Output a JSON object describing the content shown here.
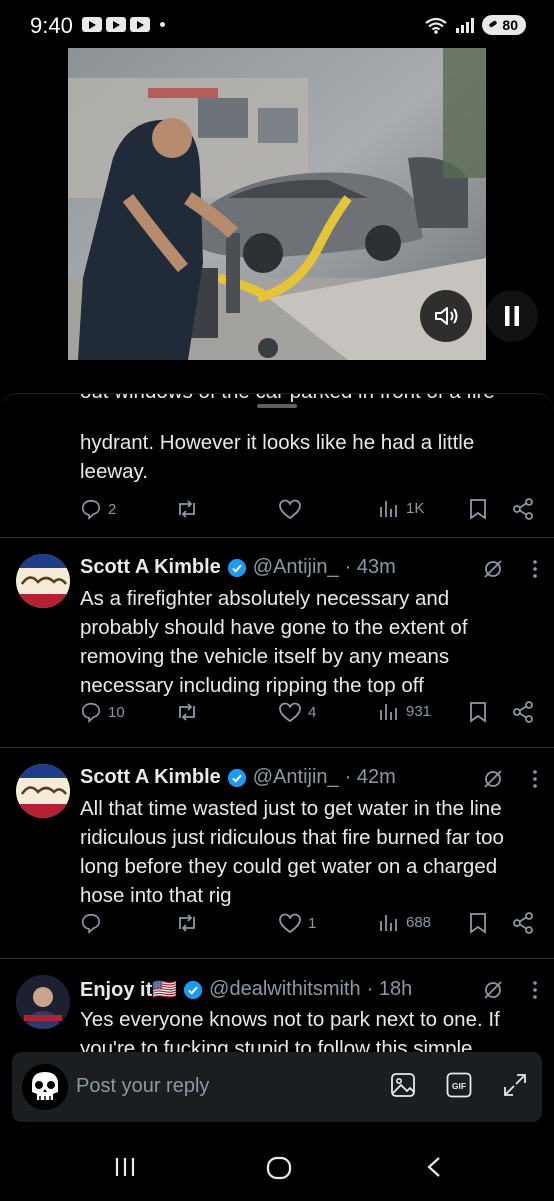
{
  "status_bar": {
    "time": "9:40",
    "battery": "80",
    "wifi_label": "6"
  },
  "video": {
    "sound_icon": "volume-icon",
    "pause_icon": "pause-icon"
  },
  "partial_tweet": {
    "cut_line": "out windows of the car parked in front of a fire",
    "text": "hydrant.  However it looks like he had a little leeway.",
    "replies": "2",
    "reposts": "",
    "likes": "",
    "views": "1K"
  },
  "tweets": [
    {
      "name": "Scott A Kimble",
      "handle": "@Antijin_",
      "time": "· 43m",
      "body": "As a firefighter absolutely necessary and probably should have gone to the extent of removing the vehicle itself by any means necessary including ripping the top off",
      "replies": "10",
      "reposts": "",
      "likes": "4",
      "views": "931"
    },
    {
      "name": "Scott A Kimble",
      "handle": "@Antijin_",
      "time": "· 42m",
      "body": "All that time wasted just to get water in the line ridiculous just ridiculous that fire burned far too long before they could get water on a charged hose into that rig",
      "replies": "",
      "reposts": "",
      "likes": "1",
      "views": "688"
    },
    {
      "name": "Enjoy it🇺🇸",
      "handle": "@dealwithitsmith",
      "time": "· 18h",
      "body": "Yes everyone knows not to park next to one. If you're to fucking stupid to follow this simple"
    }
  ],
  "reply_bar": {
    "placeholder": "Post your reply",
    "gif_label": "GIF"
  },
  "colors": {
    "accent": "#1d9bf0",
    "muted": "#8b98a5",
    "background": "#000000"
  }
}
